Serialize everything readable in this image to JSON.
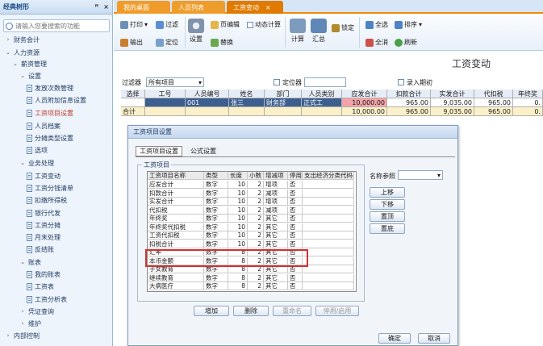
{
  "left_panel": {
    "title": "经典树形",
    "pin": "ꟸ",
    "close": "×",
    "search_placeholder": "请输入您要搜索的功能",
    "tree": [
      {
        "label": "财务会计",
        "arrow": "›"
      },
      {
        "label": "人力资源",
        "arrow": "⌄"
      },
      {
        "label": "薪资管理",
        "arrow": "⌄"
      },
      {
        "label": "设置",
        "arrow": "⌄"
      },
      {
        "label": "发放次数管理",
        "doc": true
      },
      {
        "label": "人员附加信息设置",
        "doc": true
      },
      {
        "label": "工资项目设置",
        "doc": true,
        "selected": true
      },
      {
        "label": "人员档案",
        "doc": true
      },
      {
        "label": "分摊类型设置",
        "doc": true
      },
      {
        "label": "选项",
        "doc": true
      },
      {
        "label": "业务处理",
        "arrow": "⌄"
      },
      {
        "label": "工资变动",
        "doc": true
      },
      {
        "label": "工资分钱清单",
        "doc": true
      },
      {
        "label": "扣缴所得税",
        "doc": true
      },
      {
        "label": "银行代发",
        "doc": true
      },
      {
        "label": "工资分摊",
        "doc": true
      },
      {
        "label": "月末处理",
        "doc": true
      },
      {
        "label": "反结账",
        "doc": true
      },
      {
        "label": "账表",
        "arrow": "⌄"
      },
      {
        "label": "我的账表",
        "doc": true
      },
      {
        "label": "工资表",
        "doc": true
      },
      {
        "label": "工资分析表",
        "doc": true
      },
      {
        "label": "凭证查询",
        "arrow": "›"
      },
      {
        "label": "维护",
        "arrow": "›"
      },
      {
        "label": "内部控制",
        "arrow": "›"
      }
    ]
  },
  "tabs": [
    {
      "label": "我的桌面"
    },
    {
      "label": "人员列表"
    },
    {
      "label": "工资变动",
      "active": true
    }
  ],
  "toolbar": {
    "print": "打印",
    "filter": "过滤",
    "output": "输出",
    "locate": "定位",
    "settings": "设置",
    "page_edit": "页编辑",
    "replace": "替换",
    "auto_calc": "动态计算",
    "calc": "计算",
    "summary": "汇总",
    "lock": "锁定",
    "select_all": "全选",
    "sort": "排序",
    "deselect_all": "全消",
    "refresh": "刷新"
  },
  "main": {
    "title": "工资变动",
    "filter_label": "过滤器",
    "filter_value": "所有项目",
    "locator_label": "定位器",
    "entry_label": "录入期初",
    "columns": [
      "选择",
      "工号",
      "人员编号",
      "姓名",
      "部门",
      "人员类别",
      "应发合计",
      "扣款合计",
      "实发合计",
      "代扣税",
      "年终奖"
    ],
    "rows": [
      {
        "cells": [
          "",
          "",
          "001",
          "张三",
          "财务部",
          "正式工",
          "10,000.00",
          "965.00",
          "9,035.00",
          "965.00",
          "0."
        ]
      },
      {
        "cells": [
          "合计",
          "",
          "",
          "",
          "",
          "",
          "10,000.00",
          "965.00",
          "9,035.00",
          "965.00",
          "0."
        ]
      }
    ]
  },
  "dialog": {
    "title": "工资项目设置",
    "tab1": "工资项目设置",
    "tab2": "公式设置",
    "group_label": "工资项目",
    "columns": [
      "工资项目名称",
      "类型",
      "长度",
      "小数",
      "增减项",
      "停用",
      "支出经济分类代码"
    ],
    "rows": [
      [
        "应发合计",
        "数字",
        "10",
        "2",
        "增项",
        "否",
        ""
      ],
      [
        "扣款合计",
        "数字",
        "10",
        "2",
        "减项",
        "否",
        ""
      ],
      [
        "实发合计",
        "数字",
        "10",
        "2",
        "增项",
        "否",
        ""
      ],
      [
        "代扣税",
        "数字",
        "10",
        "2",
        "减项",
        "否",
        ""
      ],
      [
        "年终奖",
        "数字",
        "10",
        "2",
        "其它",
        "否",
        ""
      ],
      [
        "年终奖代扣税",
        "数字",
        "10",
        "2",
        "其它",
        "否",
        ""
      ],
      [
        "工资代扣税",
        "数字",
        "10",
        "2",
        "其它",
        "否",
        ""
      ],
      [
        "扣税合计",
        "数字",
        "10",
        "2",
        "其它",
        "否",
        ""
      ],
      [
        "汇率",
        "数字",
        "8",
        "2",
        "其它",
        "否",
        ""
      ],
      [
        "本币金额",
        "数字",
        "8",
        "2",
        "其它",
        "否",
        ""
      ],
      [
        "子女教育",
        "数字",
        "8",
        "2",
        "其它",
        "否",
        ""
      ],
      [
        "继续教育",
        "数字",
        "8",
        "2",
        "其它",
        "否",
        ""
      ],
      [
        "大病医疗",
        "数字",
        "8",
        "2",
        "其它",
        "否",
        ""
      ]
    ],
    "name_ref_label": "名称参照",
    "move_up": "上移",
    "move_down": "下移",
    "to_top": "置顶",
    "to_bottom": "置底",
    "add": "增加",
    "delete": "删除",
    "rename": "重命名",
    "enable_disable": "停用/启用",
    "ok": "确定",
    "cancel": "取消"
  },
  "colors": {
    "tab_orange": "#f08a00",
    "highlight_red": "#d23131",
    "selected_row": "#3c5f8f",
    "pink_cell": "#f4a3a8"
  }
}
